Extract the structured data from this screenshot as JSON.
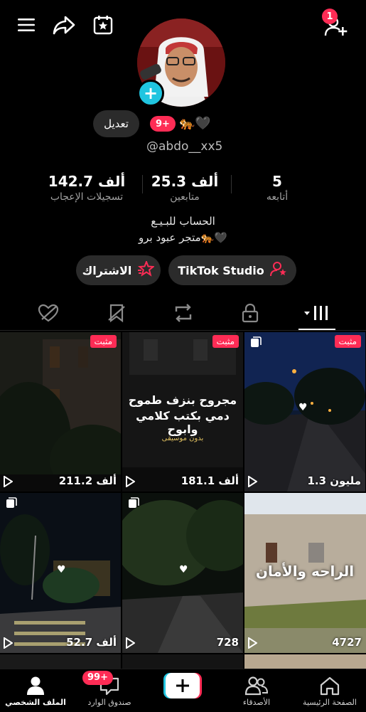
{
  "header": {
    "notification_count": "1",
    "icons": [
      "menu-icon",
      "share-icon",
      "calendar-star-icon",
      "add-friend-icon"
    ]
  },
  "profile": {
    "edit_label": "تعديل",
    "badge_label": "9+",
    "emoji_tags": "🐅🖤",
    "username": "@abdo__xx5"
  },
  "stats": [
    {
      "value": "142.7 ألف",
      "label": "تسجيلات الإعجاب"
    },
    {
      "value": "25.3 ألف",
      "label": "متابعين"
    },
    {
      "value": "5",
      "label": "أتابعه"
    }
  ],
  "bio": {
    "line1": "الحساب للبـيـع",
    "line2": "متجر عبود برو🐅🖤"
  },
  "actions": {
    "subscribe_label": "الاشتراك",
    "studio_label": "TikTok Studio"
  },
  "tabs": [
    "liked-hidden-icon",
    "favorites-hidden-icon",
    "reposts-icon",
    "private-icon",
    "videos-grid-icon"
  ],
  "videos": [
    {
      "views": "211.2 ألف",
      "pinned": "مثبت"
    },
    {
      "views": "181.1 ألف",
      "pinned": "مثبت",
      "caption1": "مجروح بنزف طموح",
      "caption2": "دمي بكتب كلامي وابوح",
      "caption3": "بدون موسيقى"
    },
    {
      "views": "1.3 مليون",
      "pinned": "مثبت"
    },
    {
      "views": "52.7 ألف"
    },
    {
      "views": "728"
    },
    {
      "views": "4727",
      "caption1": "الراحه والأمان"
    }
  ],
  "nav": {
    "profile": "الملف الشخصي",
    "inbox": "صندوق الوارد",
    "inbox_badge": "99+",
    "friends": "الأصدقاء",
    "home": "الصفحة الرئيسية"
  },
  "colors": {
    "accent": "#fe2c55",
    "cyan": "#20c5e0",
    "pill_bg": "#2b2b2b"
  }
}
